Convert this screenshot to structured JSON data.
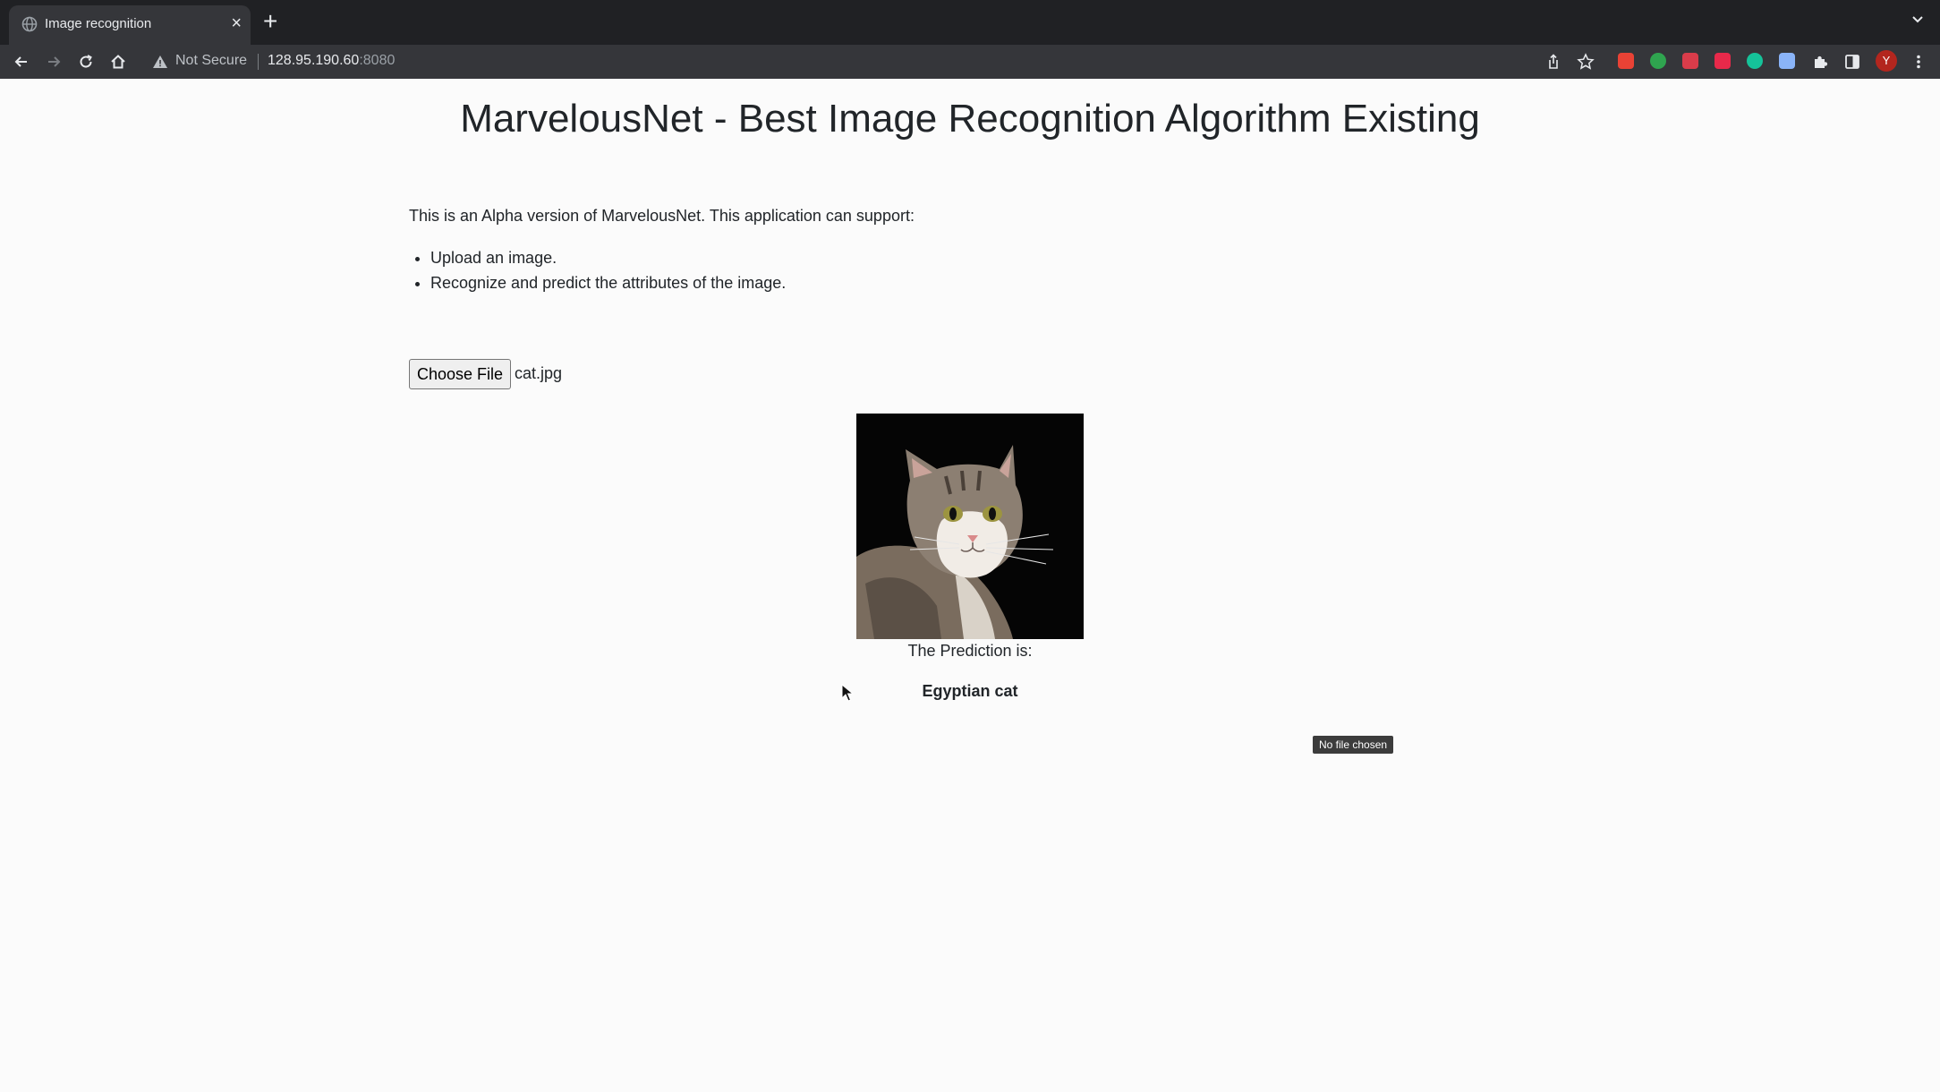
{
  "browser": {
    "tab": {
      "title": "Image recognition",
      "close": "×"
    },
    "new_tab": "+",
    "address": {
      "security_label": "Not Secure",
      "host": "128.95.190.60",
      "port": ":8080"
    },
    "profile_initial": "Y",
    "extensions": [
      {
        "name": "extension-red-square",
        "color": "#e94235"
      },
      {
        "name": "extension-green-refresh",
        "color": "#2fa44f"
      },
      {
        "name": "extension-red-shield",
        "color": "#d93c4a"
      },
      {
        "name": "extension-red-pill",
        "color": "#e8294a"
      },
      {
        "name": "extension-grammarly",
        "color": "#15c39a"
      },
      {
        "name": "extension-calendar",
        "color": "#8ab4f8"
      }
    ]
  },
  "page": {
    "title": "MarvelousNet - Best Image Recognition Algorithm Existing",
    "intro": "This is an Alpha version of MarvelousNet. This application can support:",
    "features": [
      "Upload an image.",
      "Recognize and predict the attributes of the image."
    ],
    "upload": {
      "button_label": "Choose File",
      "file_name": "cat.jpg"
    },
    "prediction_label": "The Prediction is:",
    "prediction_value": "Egyptian cat",
    "tooltip": "No file chosen"
  }
}
